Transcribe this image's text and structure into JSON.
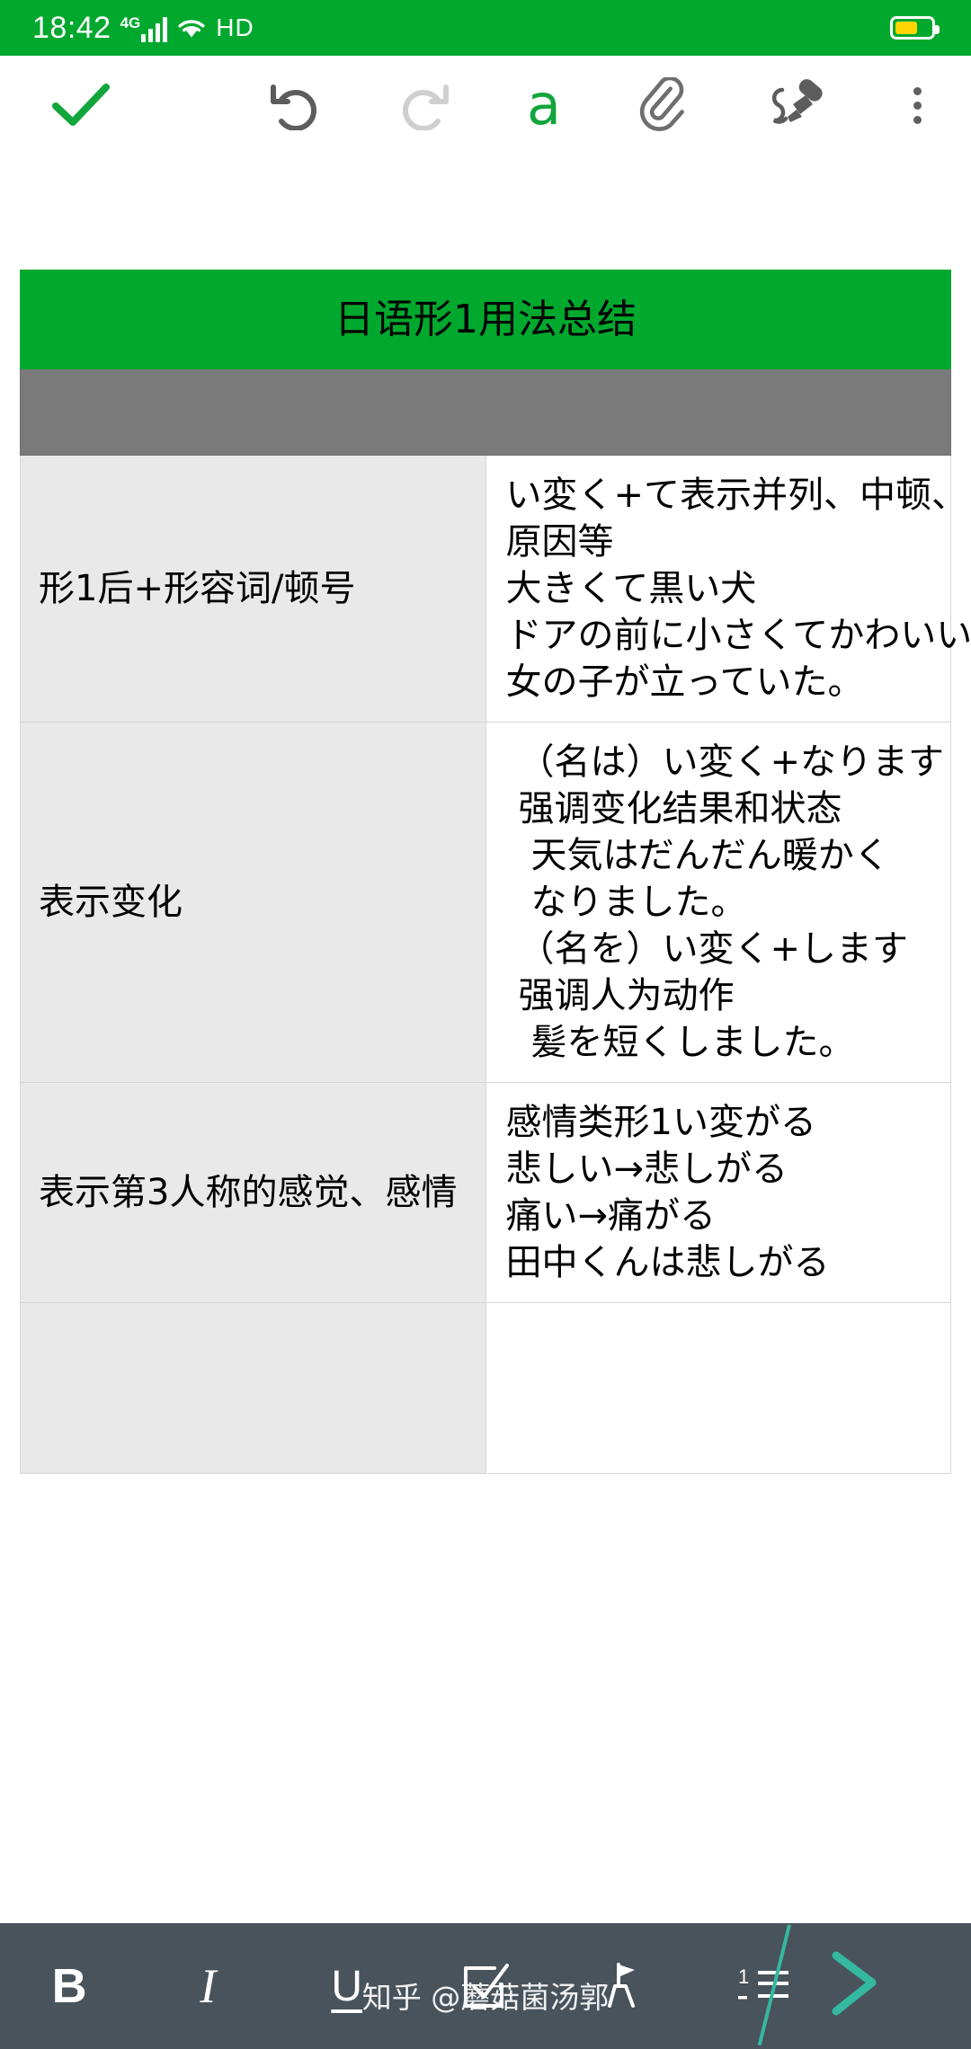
{
  "status_bar": {
    "time": "18:42",
    "network_label": "4G",
    "hd_label": "HD",
    "battery_percent": 62,
    "background_color": "#00a82d",
    "icons": [
      "signal-bars-icon",
      "wifi-icon",
      "battery-icon"
    ]
  },
  "top_toolbar": {
    "accent_color": "#11a53b",
    "buttons": [
      {
        "name": "done-check-button",
        "icon": "check-icon",
        "label": ""
      },
      {
        "name": "undo-button",
        "icon": "undo-icon",
        "label": ""
      },
      {
        "name": "redo-button",
        "icon": "redo-icon",
        "label": ""
      },
      {
        "name": "text-format-button",
        "icon": "text-format-icon",
        "label": "a"
      },
      {
        "name": "attachment-button",
        "icon": "paperclip-icon",
        "label": ""
      },
      {
        "name": "handwriting-button",
        "icon": "pen-icon",
        "label": ""
      },
      {
        "name": "more-options-button",
        "icon": "more-vertical-icon",
        "label": ""
      }
    ]
  },
  "document": {
    "table": {
      "title": "日语形1用法总结",
      "title_bg": "#00a82d",
      "subheader_bg": "#7a7a7a",
      "subheader_text": "",
      "label_column_bg": "#e9e9e9",
      "rows": [
        {
          "label": "形1后+形容词/顿号",
          "lines": [
            {
              "text": "い変く+て表示并列、中顿、",
              "indent": 0
            },
            {
              "text": "原因等",
              "indent": 0
            },
            {
              "text": "大きくて黒い犬",
              "indent": 0
            },
            {
              "text": "ドアの前に小さくてかわいい",
              "indent": 0
            },
            {
              "text": "女の子が立っていた。",
              "indent": 0
            }
          ]
        },
        {
          "label": "表示变化",
          "lines": [
            {
              "text": "（名は）い変く+なります",
              "indent": 1
            },
            {
              "text": "强调变化结果和状态",
              "indent": 1
            },
            {
              "text": "天気はだんだん暖かく",
              "indent": 2
            },
            {
              "text": "なりました。",
              "indent": 2
            },
            {
              "text": "（名を）い変く+します",
              "indent": 1
            },
            {
              "text": "强调人为动作",
              "indent": 1
            },
            {
              "text": "髪を短くしました。",
              "indent": 2
            }
          ]
        },
        {
          "label": "表示第3人称的感觉、感情",
          "lines": [
            {
              "text": "感情类形1い変がる",
              "indent": 0
            },
            {
              "text": "悲しい→悲しがる",
              "indent": 0
            },
            {
              "text": "痛い→痛がる",
              "indent": 0
            },
            {
              "text": "田中くんは悲しがる",
              "indent": 0
            }
          ]
        },
        {
          "label": "",
          "lines": []
        }
      ]
    }
  },
  "bottom_toolbar": {
    "background_color": "#48535b",
    "buttons": [
      {
        "name": "bold-button",
        "icon": "bold-icon",
        "label": "B"
      },
      {
        "name": "italic-button",
        "icon": "italic-icon",
        "label": "I"
      },
      {
        "name": "underline-button",
        "icon": "underline-icon",
        "label": "U"
      },
      {
        "name": "checklist-button",
        "icon": "checkbox-icon",
        "label": ""
      },
      {
        "name": "highlighter-button",
        "icon": "highlighter-icon",
        "label": ""
      },
      {
        "name": "numbered-list-button",
        "icon": "numbered-list-icon",
        "label": "1"
      },
      {
        "name": "next-button",
        "icon": "chevron-right-icon",
        "label": ""
      }
    ]
  },
  "watermark": {
    "text": "知乎 @蘑菇菌汤郭",
    "accent_color": "#35b8a0"
  }
}
